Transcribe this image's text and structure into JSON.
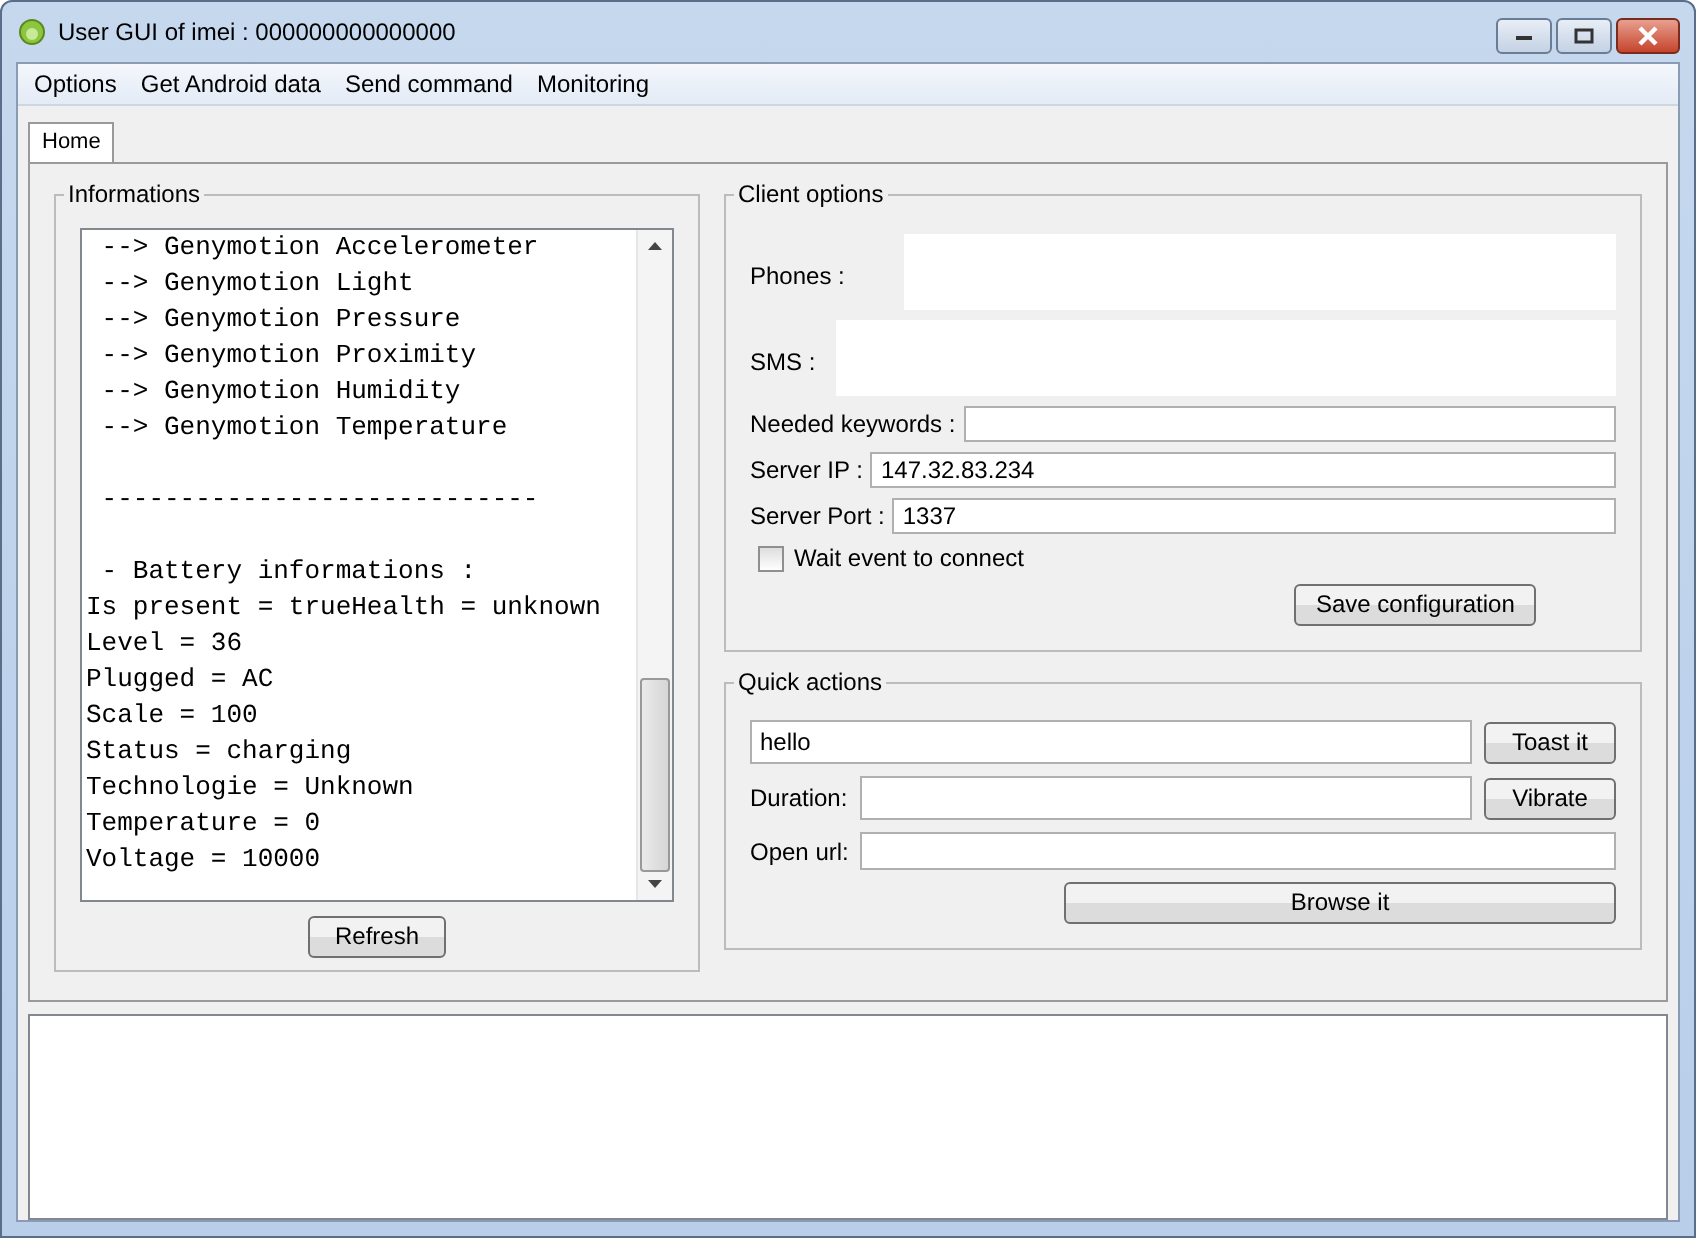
{
  "window": {
    "title": "User GUI of imei : 000000000000000"
  },
  "menu": [
    "Options",
    "Get Android data",
    "Send command",
    "Monitoring"
  ],
  "tabs": [
    {
      "label": "Home",
      "selected": true
    }
  ],
  "informations": {
    "title": "Informations",
    "log_blocks": [
      [
        " --> Genymotion Accelerometer",
        " --> Genymotion Light",
        " --> Genymotion Pressure",
        " --> Genymotion Proximity",
        " --> Genymotion Humidity",
        " --> Genymotion Temperature"
      ],
      [
        " ----------------------------"
      ],
      [
        " - Battery informations :",
        "Is present = trueHealth = unknown",
        "Level = 36",
        "Plugged = AC",
        "Scale = 100",
        "Status = charging",
        "Technologie = Unknown",
        "Temperature = 0",
        "Voltage = 10000"
      ]
    ],
    "refresh_button": "Refresh"
  },
  "client_options": {
    "title": "Client options",
    "fields": [
      {
        "kind": "area",
        "label": "Phones :"
      },
      {
        "kind": "area",
        "label": "SMS :"
      },
      {
        "kind": "line",
        "label": "Needed keywords :"
      },
      {
        "kind": "line",
        "label": "Server IP :",
        "value": "147.32.83.234"
      },
      {
        "kind": "line",
        "label": "Server Port :",
        "value": "1337"
      }
    ],
    "checkbox": {
      "label": "Wait event to connect",
      "checked": false
    },
    "save_button": "Save configuration"
  },
  "quick_actions": {
    "title": "Quick actions",
    "toast_value": "hello",
    "toast_button": "Toast it",
    "duration_label": "Duration:",
    "vibrate_button": "Vibrate",
    "url_label": "Open url:",
    "browse_button": "Browse it"
  }
}
